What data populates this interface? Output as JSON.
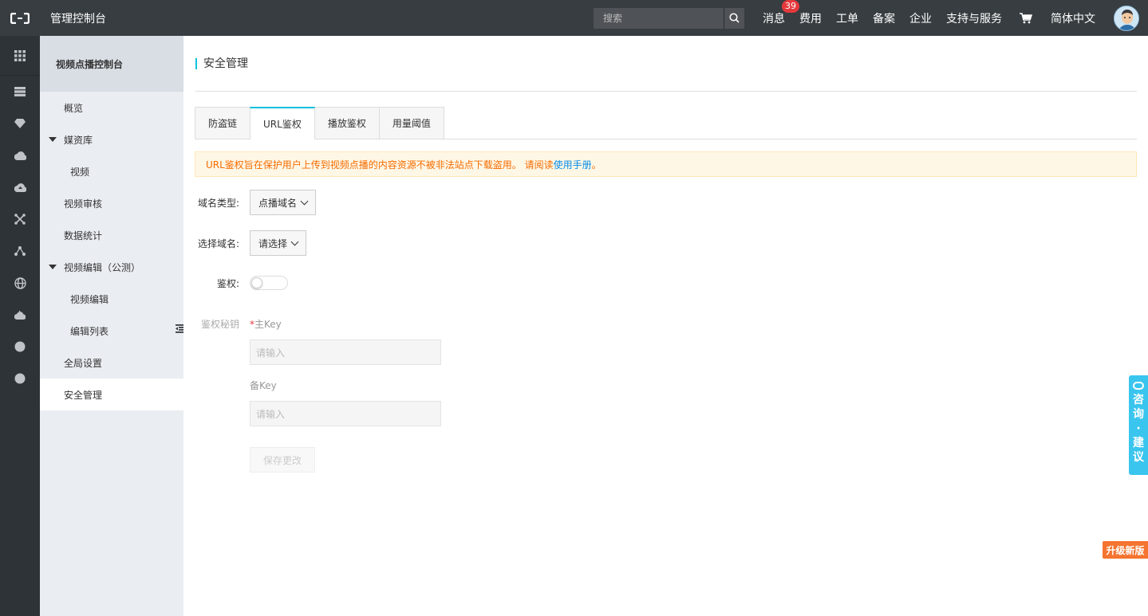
{
  "topbar": {
    "title": "管理控制台",
    "search_placeholder": "搜索",
    "nav": {
      "messages": "消息",
      "messages_badge": "39",
      "billing": "费用",
      "tickets": "工单",
      "icp": "备案",
      "enterprise": "企业",
      "support": "支持与服务",
      "language": "简体中文"
    }
  },
  "sidebar": {
    "header": "视频点播控制台",
    "items": {
      "overview": "概览",
      "media_library": "媒资库",
      "video": "视频",
      "video_review": "视频审核",
      "data_stats": "数据统计",
      "video_edit_group": "视频编辑（公测）",
      "video_edit": "视频编辑",
      "edit_list": "编辑列表",
      "global_settings": "全局设置",
      "security": "安全管理"
    }
  },
  "main": {
    "page_title": "安全管理",
    "tabs": [
      "防盗链",
      "URL鉴权",
      "播放鉴权",
      "用量阈值"
    ],
    "notice_text": "URL鉴权旨在保护用户上传到视频点播的内容资源不被非法站点下载盗用。 请阅读 ",
    "notice_link": "使用手册",
    "notice_tail": "。",
    "form": {
      "domain_type_label": "域名类型:",
      "domain_type_value": "点播域名",
      "domain_label": "选择域名:",
      "domain_value": "请选择",
      "auth_label": "鉴权:",
      "secret_label": "鉴权秘钥",
      "primary_key_req": "*",
      "primary_key_label": "主Key",
      "primary_key_placeholder": "请输入",
      "backup_key_label": "备Key",
      "backup_key_placeholder": "请输入",
      "save_label": "保存更改"
    }
  },
  "floating": {
    "feedback": [
      "咨",
      "询",
      "·",
      "建",
      "议"
    ],
    "upgrade": "升级新版"
  },
  "colors": {
    "topbar": "#373d41",
    "rail": "#2e3338",
    "accent": "#00c1de",
    "notice_text": "#f56c00",
    "link": "#0a8ee6",
    "badge": "#e4393c",
    "upgrade": "#f5742f"
  }
}
